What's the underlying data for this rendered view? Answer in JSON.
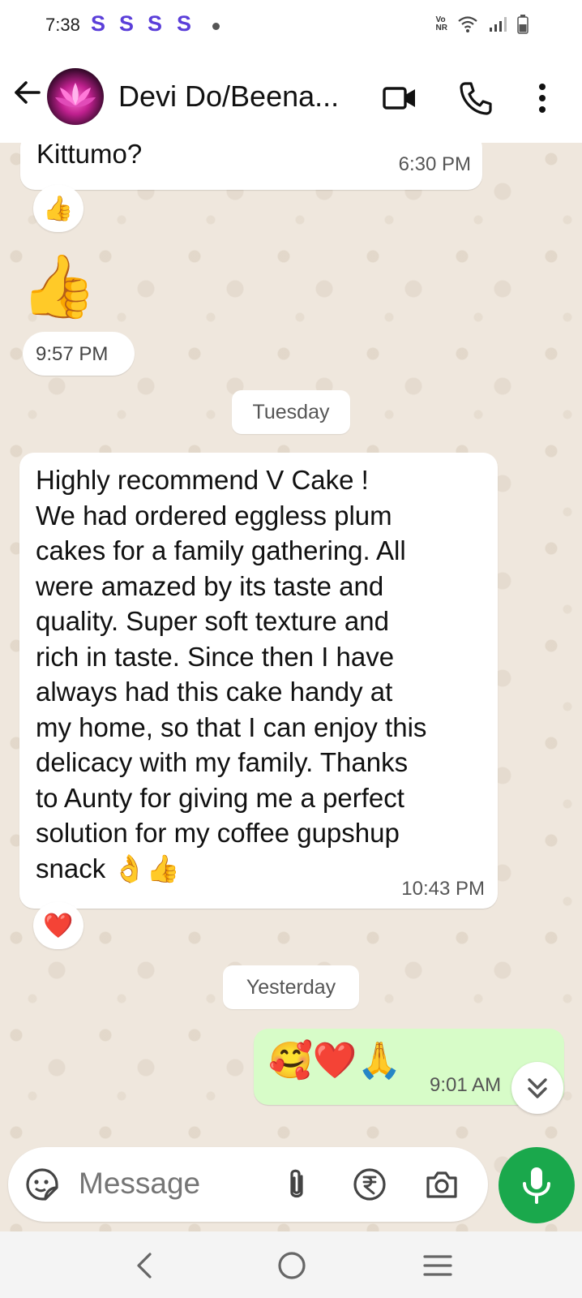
{
  "status_bar": {
    "time": "7:38",
    "s_icons": [
      "S",
      "S",
      "S",
      "S"
    ],
    "network_label_top": "Vo",
    "network_label_bottom": "NR"
  },
  "header": {
    "contact_name": "Devi Do/Beena..."
  },
  "messages": [
    {
      "direction": "incoming",
      "text": "Kittumo?",
      "time": "6:30 PM",
      "reaction": "👍"
    },
    {
      "direction": "incoming",
      "text": "👍",
      "time": "9:57 PM"
    },
    {
      "direction": "incoming",
      "text": "Highly recommend V Cake !\nWe had ordered eggless plum\ncakes for a family gathering. All\nwere amazed by its taste and\nquality. Super soft texture and\nrich in taste. Since then I have\nalways had this cake handy at\nmy home, so that I can enjoy this\ndelicacy with my family. Thanks\nto Aunty for giving me a perfect\nsolution for my coffee gupshup\nsnack 👌👍",
      "time": "10:43 PM",
      "reaction": "❤️"
    },
    {
      "direction": "outgoing",
      "text": "🥰❤️🙏",
      "time": "9:01 AM"
    }
  ],
  "date_chips": {
    "tuesday": "Tuesday",
    "yesterday": "Yesterday"
  },
  "composer": {
    "placeholder": "Message"
  },
  "colors": {
    "chat_background": "#efe7dd",
    "incoming_bubble": "#ffffff",
    "outgoing_bubble": "#d7fcc8",
    "mic_button": "#1aa84c",
    "status_s": "#5b3fd9",
    "read_ticks": "#4fb6ec"
  },
  "icons": {
    "back": "arrow-left-icon",
    "video": "video-camera-icon",
    "call": "phone-icon",
    "menu": "more-vertical-icon",
    "sticker": "sticker-icon",
    "attach": "paperclip-icon",
    "payment": "rupee-icon",
    "camera": "camera-icon",
    "mic": "microphone-icon",
    "scroll_down": "double-chevron-down-icon"
  }
}
